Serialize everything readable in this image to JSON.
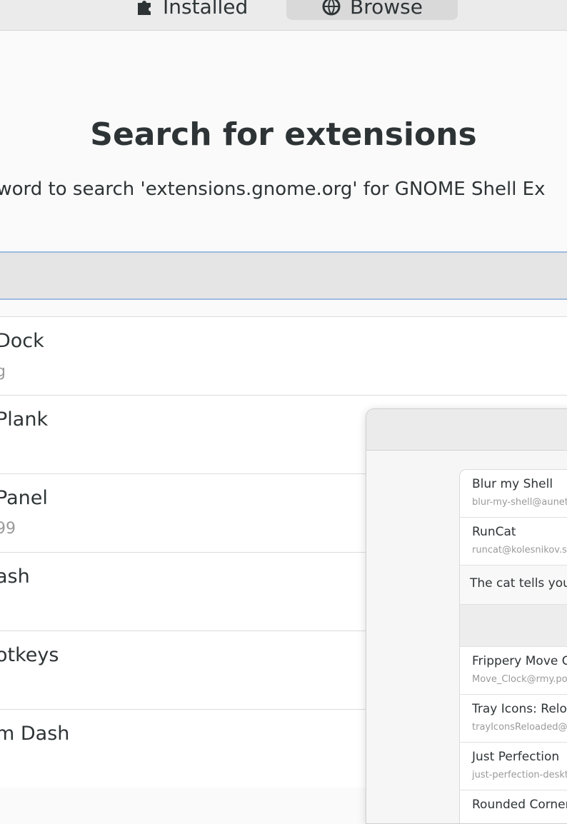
{
  "tabs": {
    "installed_label": "Installed",
    "browse_label": "Browse"
  },
  "hero": {
    "title": "Search for extensions",
    "description": "eyword to search 'extensions.gnome.org' for GNOME Shell Ex"
  },
  "search": {
    "value": ""
  },
  "results": [
    {
      "name": "Dock",
      "sub": "g"
    },
    {
      "name": "Plank",
      "sub": ""
    },
    {
      "name": "Panel",
      "sub": "99"
    },
    {
      "name": "ash",
      "sub": ""
    },
    {
      "name": "otkeys",
      "sub": ""
    },
    {
      "name": "m Dash",
      "sub": ""
    }
  ],
  "overlay": {
    "items": [
      {
        "name": "Blur my Shell",
        "id": "blur-my-shell@aunetx"
      },
      {
        "name": "RunCat",
        "id": "runcat@kolesnikov.se"
      }
    ],
    "description": "The cat tells you the",
    "items2": [
      {
        "name": "Frippery Move Clock",
        "id": "Move_Clock@rmy.pobox.com"
      },
      {
        "name": "Tray Icons: Reloaded",
        "id": "trayIconsReloaded@selfmade"
      },
      {
        "name": "Just Perfection",
        "id": "just-perfection-desktop"
      },
      {
        "name": "Rounded Corners",
        "id": ""
      }
    ]
  }
}
